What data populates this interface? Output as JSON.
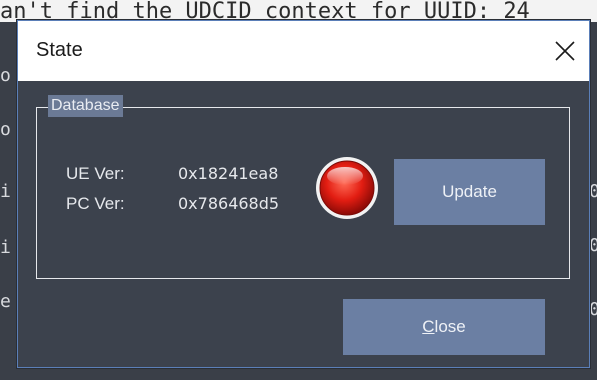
{
  "background": {
    "top_text": "an't find the UDCID context for UUID: 24",
    "left_chars": [
      "o",
      "o",
      "i",
      "i",
      "e"
    ],
    "right_chars": [
      "0",
      "0",
      "0"
    ]
  },
  "dialog": {
    "title": "State",
    "close_icon": "close-icon",
    "group_label": "Database",
    "ue_label": "UE Ver:",
    "ue_value": "0x18241ea8",
    "pc_label": "PC Ver:",
    "pc_value": "0x786468d5",
    "status_led": {
      "icon": "red-status-led",
      "color": "#e02020"
    },
    "update_label": "Update",
    "close_label_rest": "lose",
    "close_label_accel": "C"
  },
  "colors": {
    "dialog_bg": "#3c424d",
    "button_bg": "#6b7fa3",
    "accent_border": "#5b7fb8"
  }
}
